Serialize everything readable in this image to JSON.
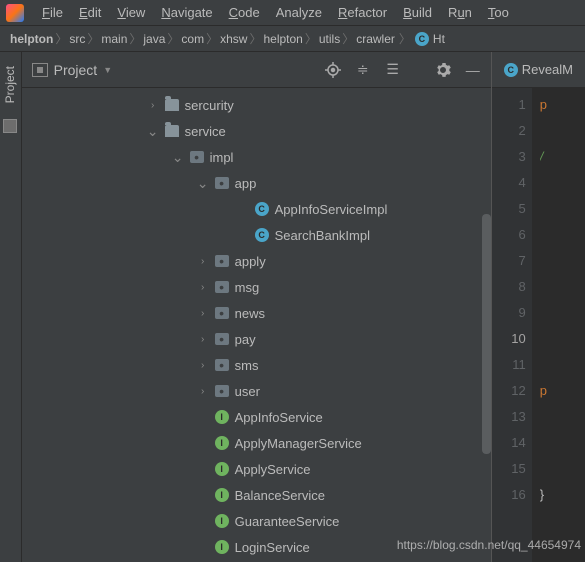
{
  "menu": {
    "items": [
      {
        "label": "File",
        "u": "F",
        "rest": "ile"
      },
      {
        "label": "Edit",
        "u": "E",
        "rest": "dit"
      },
      {
        "label": "View",
        "u": "V",
        "rest": "iew"
      },
      {
        "label": "Navigate",
        "u": "N",
        "rest": "avigate"
      },
      {
        "label": "Code",
        "u": "C",
        "rest": "ode"
      },
      {
        "label": "Analyze",
        "u": "",
        "rest": "Analyze"
      },
      {
        "label": "Refactor",
        "u": "R",
        "rest": "efactor"
      },
      {
        "label": "Build",
        "u": "B",
        "rest": "uild"
      },
      {
        "label": "Run",
        "u": "",
        "rest": "R"
      },
      {
        "label": "Tools",
        "u": "T",
        "rest": "oo"
      }
    ],
    "run_u": "u",
    "run_rest": "n"
  },
  "breadcrumb": {
    "items": [
      "helpton",
      "src",
      "main",
      "java",
      "com",
      "xhsw",
      "helpton",
      "utils",
      "crawler"
    ],
    "class_glyph": "C",
    "class_name": "Ht"
  },
  "leftRail": {
    "project": "Project"
  },
  "panel": {
    "title": "Project"
  },
  "tree": {
    "rows": [
      {
        "indent": 125,
        "arrow": "right",
        "icon": "folder",
        "label": "sercurity"
      },
      {
        "indent": 125,
        "arrow": "down",
        "icon": "folder",
        "label": "service"
      },
      {
        "indent": 150,
        "arrow": "down",
        "icon": "pkg",
        "label": "impl"
      },
      {
        "indent": 175,
        "arrow": "down",
        "icon": "pkg",
        "label": "app"
      },
      {
        "indent": 215,
        "arrow": "",
        "icon": "c",
        "label": "AppInfoServiceImpl"
      },
      {
        "indent": 215,
        "arrow": "",
        "icon": "c",
        "label": "SearchBankImpl"
      },
      {
        "indent": 175,
        "arrow": "right",
        "icon": "pkg",
        "label": "apply"
      },
      {
        "indent": 175,
        "arrow": "right",
        "icon": "pkg",
        "label": "msg"
      },
      {
        "indent": 175,
        "arrow": "right",
        "icon": "pkg",
        "label": "news"
      },
      {
        "indent": 175,
        "arrow": "right",
        "icon": "pkg",
        "label": "pay"
      },
      {
        "indent": 175,
        "arrow": "right",
        "icon": "pkg",
        "label": "sms"
      },
      {
        "indent": 175,
        "arrow": "right",
        "icon": "pkg",
        "label": "user"
      },
      {
        "indent": 175,
        "arrow": "",
        "icon": "i",
        "label": "AppInfoService"
      },
      {
        "indent": 175,
        "arrow": "",
        "icon": "i",
        "label": "ApplyManagerService"
      },
      {
        "indent": 175,
        "arrow": "",
        "icon": "i",
        "label": "ApplyService"
      },
      {
        "indent": 175,
        "arrow": "",
        "icon": "i",
        "label": "BalanceService"
      },
      {
        "indent": 175,
        "arrow": "",
        "icon": "i",
        "label": "GuaranteeService"
      },
      {
        "indent": 175,
        "arrow": "",
        "icon": "i",
        "label": "LoginService"
      }
    ]
  },
  "editor": {
    "tab_glyph": "C",
    "tab_name": "RevealM",
    "lines": [
      1,
      2,
      3,
      4,
      5,
      6,
      7,
      8,
      9,
      10,
      11,
      12,
      13,
      14,
      15,
      16
    ],
    "highlight": 10,
    "code": {
      "l1": "p",
      "l3": "/",
      "l12": "p",
      "l16": "}"
    }
  },
  "watermark": "https://blog.csdn.net/qq_44654974"
}
